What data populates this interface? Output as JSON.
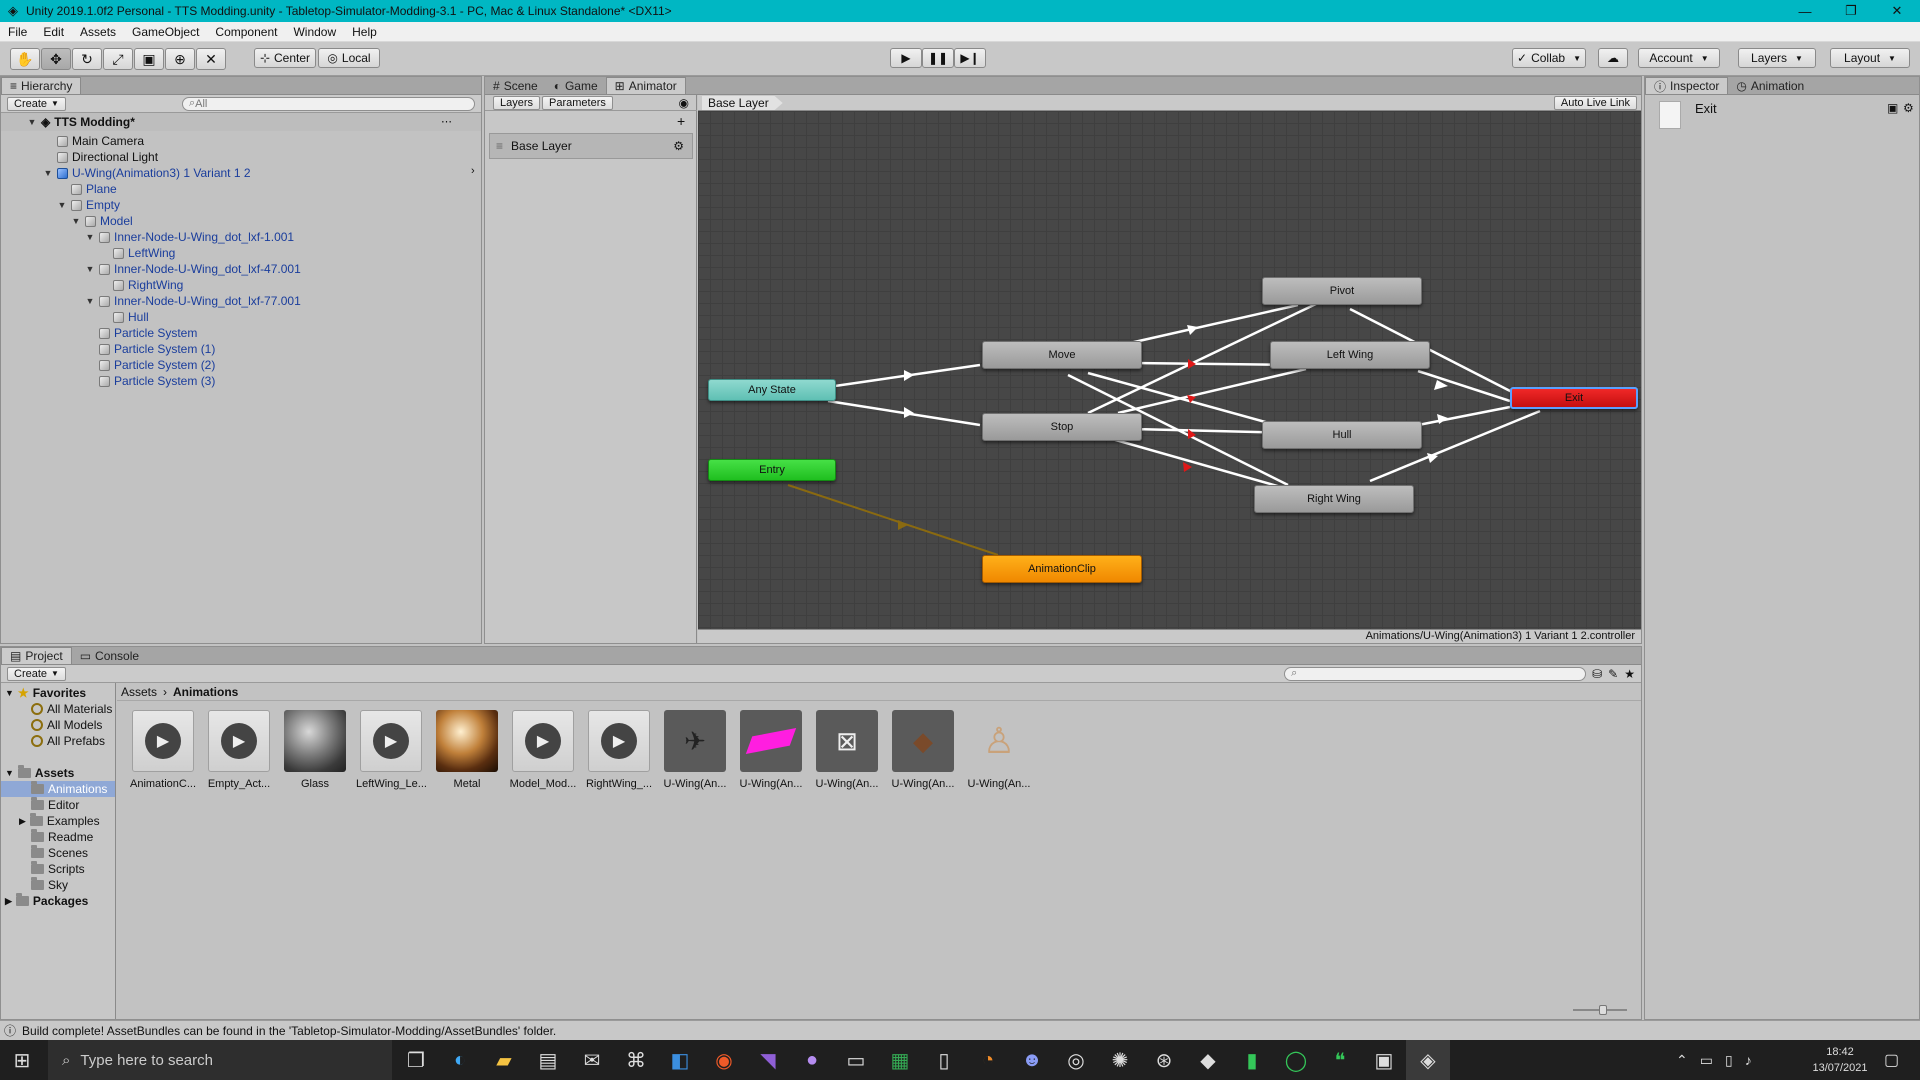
{
  "window": {
    "title": "Unity 2019.1.0f2 Personal - TTS Modding.unity - Tabletop-Simulator-Modding-3.1 - PC, Mac & Linux Standalone* <DX11>",
    "minimize": "—",
    "maximize": "❐",
    "close": "✕"
  },
  "menu": [
    "File",
    "Edit",
    "Assets",
    "GameObject",
    "Component",
    "Window",
    "Help"
  ],
  "toolbar": {
    "center_label": "Center",
    "local_label": "Local",
    "collab_label": "Collab",
    "account_label": "Account",
    "layers_label": "Layers",
    "layout_label": "Layout"
  },
  "hierarchy": {
    "tab": "Hierarchy",
    "create": "Create",
    "search_placeholder": "All",
    "scene": "TTS Modding*",
    "rows": [
      "Main Camera",
      "Directional Light",
      "U-Wing(Animation3) 1 Variant 1 2",
      "Plane",
      "Empty",
      "Model",
      "Inner-Node-U-Wing_dot_lxf-1.001",
      "LeftWing",
      "Inner-Node-U-Wing_dot_lxf-47.001",
      "RightWing",
      "Inner-Node-U-Wing_dot_lxf-77.001",
      "Hull",
      "Particle System",
      "Particle System (1)",
      "Particle System (2)",
      "Particle System (3)"
    ]
  },
  "center_tabs": {
    "scene": "Scene",
    "game": "Game",
    "animator": "Animator"
  },
  "animator": {
    "layers_tab": "Layers",
    "parameters_tab": "Parameters",
    "layer_name": "Base Layer",
    "breadcrumb": "Base Layer",
    "auto_live_link": "Auto Live Link",
    "footer_path": "Animations/U-Wing(Animation3) 1 Variant 1 2.controller",
    "states": {
      "any_state": "Any State",
      "entry": "Entry",
      "move": "Move",
      "stop": "Stop",
      "pivot": "Pivot",
      "left_wing": "Left Wing",
      "hull": "Hull",
      "right_wing": "Right Wing",
      "exit": "Exit",
      "animation_clip": "AnimationClip"
    }
  },
  "inspector": {
    "tab": "Inspector",
    "animation_tab": "Animation",
    "selected": "Exit"
  },
  "project": {
    "project_tab": "Project",
    "console_tab": "Console",
    "create": "Create",
    "breadcrumb_root": "Assets",
    "breadcrumb_current": "Animations",
    "favorites": "Favorites",
    "fav_items": [
      "All Materials",
      "All Models",
      "All Prefabs"
    ],
    "assets_root": "Assets",
    "folders": [
      "Animations",
      "Editor",
      "Examples",
      "Readme",
      "Scenes",
      "Scripts",
      "Sky"
    ],
    "packages": "Packages",
    "assets": [
      "AnimationC...",
      "Empty_Act...",
      "Glass",
      "LeftWing_Le...",
      "Metal",
      "Model_Mod...",
      "RightWing_...",
      "U-Wing(An...",
      "U-Wing(An...",
      "U-Wing(An...",
      "U-Wing(An...",
      "U-Wing(An..."
    ]
  },
  "status_bar": "Build complete! AssetBundles can be found in the 'Tabletop-Simulator-Modding/AssetBundles' folder.",
  "taskbar": {
    "search_placeholder": "Type here to search",
    "time": "18:42",
    "date": "13/07/2021"
  }
}
